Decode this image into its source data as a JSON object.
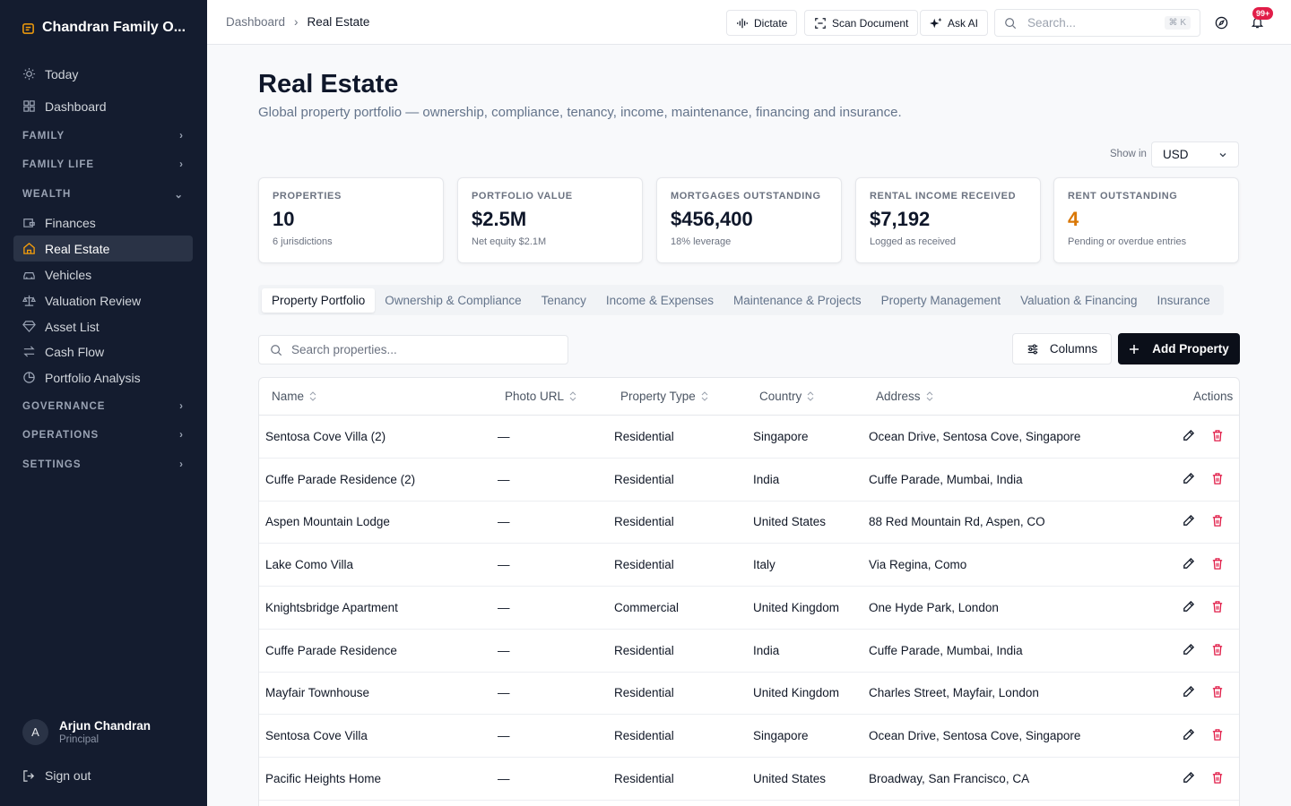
{
  "app": {
    "title": "Chandran Family O..."
  },
  "sidebar": {
    "top_items": [
      {
        "label": "Today",
        "icon": "sun-icon"
      },
      {
        "label": "Dashboard",
        "icon": "grid-icon"
      }
    ],
    "sections": [
      {
        "label": "FAMILY"
      },
      {
        "label": "FAMILY LIFE"
      },
      {
        "label": "WEALTH"
      },
      {
        "label": "GOVERNANCE"
      },
      {
        "label": "OPERATIONS"
      },
      {
        "label": "SETTINGS"
      }
    ],
    "wealth_items": [
      {
        "label": "Finances",
        "icon": "wallet-icon"
      },
      {
        "label": "Real Estate",
        "icon": "house-icon",
        "active": true
      },
      {
        "label": "Vehicles",
        "icon": "car-icon"
      },
      {
        "label": "Valuation Review",
        "icon": "scale-icon"
      },
      {
        "label": "Asset List",
        "icon": "gem-icon"
      },
      {
        "label": "Cash Flow",
        "icon": "arrows-icon"
      },
      {
        "label": "Portfolio Analysis",
        "icon": "pie-icon"
      }
    ],
    "user": {
      "initial": "A",
      "name": "Arjun Chandran",
      "role": "Principal"
    },
    "sign_out": "Sign out"
  },
  "topbar": {
    "breadcrumb": [
      "Dashboard",
      "Real Estate"
    ],
    "dictate": "Dictate",
    "scan": "Scan Document",
    "ask_ai": "Ask AI",
    "search_placeholder": "Search...",
    "shortcut": "⌘ K",
    "notifications": "99+"
  },
  "page": {
    "title": "Real Estate",
    "subtitle": "Global property portfolio — ownership, compliance, tenancy, income, maintenance, financing and insurance.",
    "currency_label": "Show in",
    "currency": "USD"
  },
  "stats": [
    {
      "label": "PROPERTIES",
      "value": "10",
      "note": "6 jurisdictions"
    },
    {
      "label": "PORTFOLIO VALUE",
      "value": "$2.5M",
      "note": "Net equity $2.1M"
    },
    {
      "label": "MORTGAGES OUTSTANDING",
      "value": "$456,400",
      "note": "18% leverage"
    },
    {
      "label": "RENTAL INCOME RECEIVED",
      "value": "$7,192",
      "note": "Logged as received"
    },
    {
      "label": "RENT OUTSTANDING",
      "value": "4",
      "note": "Pending or overdue entries"
    }
  ],
  "colors": {
    "sidebar_bg": "#141c2f",
    "accent_orange": "#d97706",
    "danger": "#e11d48",
    "primary_button": "#0b0f19"
  },
  "tabs": [
    "Property Portfolio",
    "Ownership & Compliance",
    "Tenancy",
    "Income & Expenses",
    "Maintenance & Projects",
    "Property Management",
    "Valuation & Financing",
    "Insurance"
  ],
  "table": {
    "search_placeholder": "Search properties...",
    "columns_button": "Columns",
    "add_button": "Add Property",
    "headers": [
      "Name",
      "Photo URL",
      "Property Type",
      "Country",
      "Address",
      "Actions"
    ],
    "rows": [
      {
        "name": "Sentosa Cove Villa (2)",
        "photo": "—",
        "type": "Residential",
        "country": "Singapore",
        "address": "Ocean Drive, Sentosa Cove, Singapore"
      },
      {
        "name": "Cuffe Parade Residence (2)",
        "photo": "—",
        "type": "Residential",
        "country": "India",
        "address": "Cuffe Parade, Mumbai, India"
      },
      {
        "name": "Aspen Mountain Lodge",
        "photo": "—",
        "type": "Residential",
        "country": "United States",
        "address": "88 Red Mountain Rd, Aspen, CO"
      },
      {
        "name": "Lake Como Villa",
        "photo": "—",
        "type": "Residential",
        "country": "Italy",
        "address": "Via Regina, Como"
      },
      {
        "name": "Knightsbridge Apartment",
        "photo": "—",
        "type": "Commercial",
        "country": "United Kingdom",
        "address": "One Hyde Park, London"
      },
      {
        "name": "Cuffe Parade Residence",
        "photo": "—",
        "type": "Residential",
        "country": "India",
        "address": "Cuffe Parade, Mumbai, India"
      },
      {
        "name": "Mayfair Townhouse",
        "photo": "—",
        "type": "Residential",
        "country": "United Kingdom",
        "address": "Charles Street, Mayfair, London"
      },
      {
        "name": "Sentosa Cove Villa",
        "photo": "—",
        "type": "Residential",
        "country": "Singapore",
        "address": "Ocean Drive, Sentosa Cove, Singapore"
      },
      {
        "name": "Pacific Heights Home",
        "photo": "—",
        "type": "Residential",
        "country": "United States",
        "address": "Broadway, San Francisco, CA"
      }
    ]
  }
}
